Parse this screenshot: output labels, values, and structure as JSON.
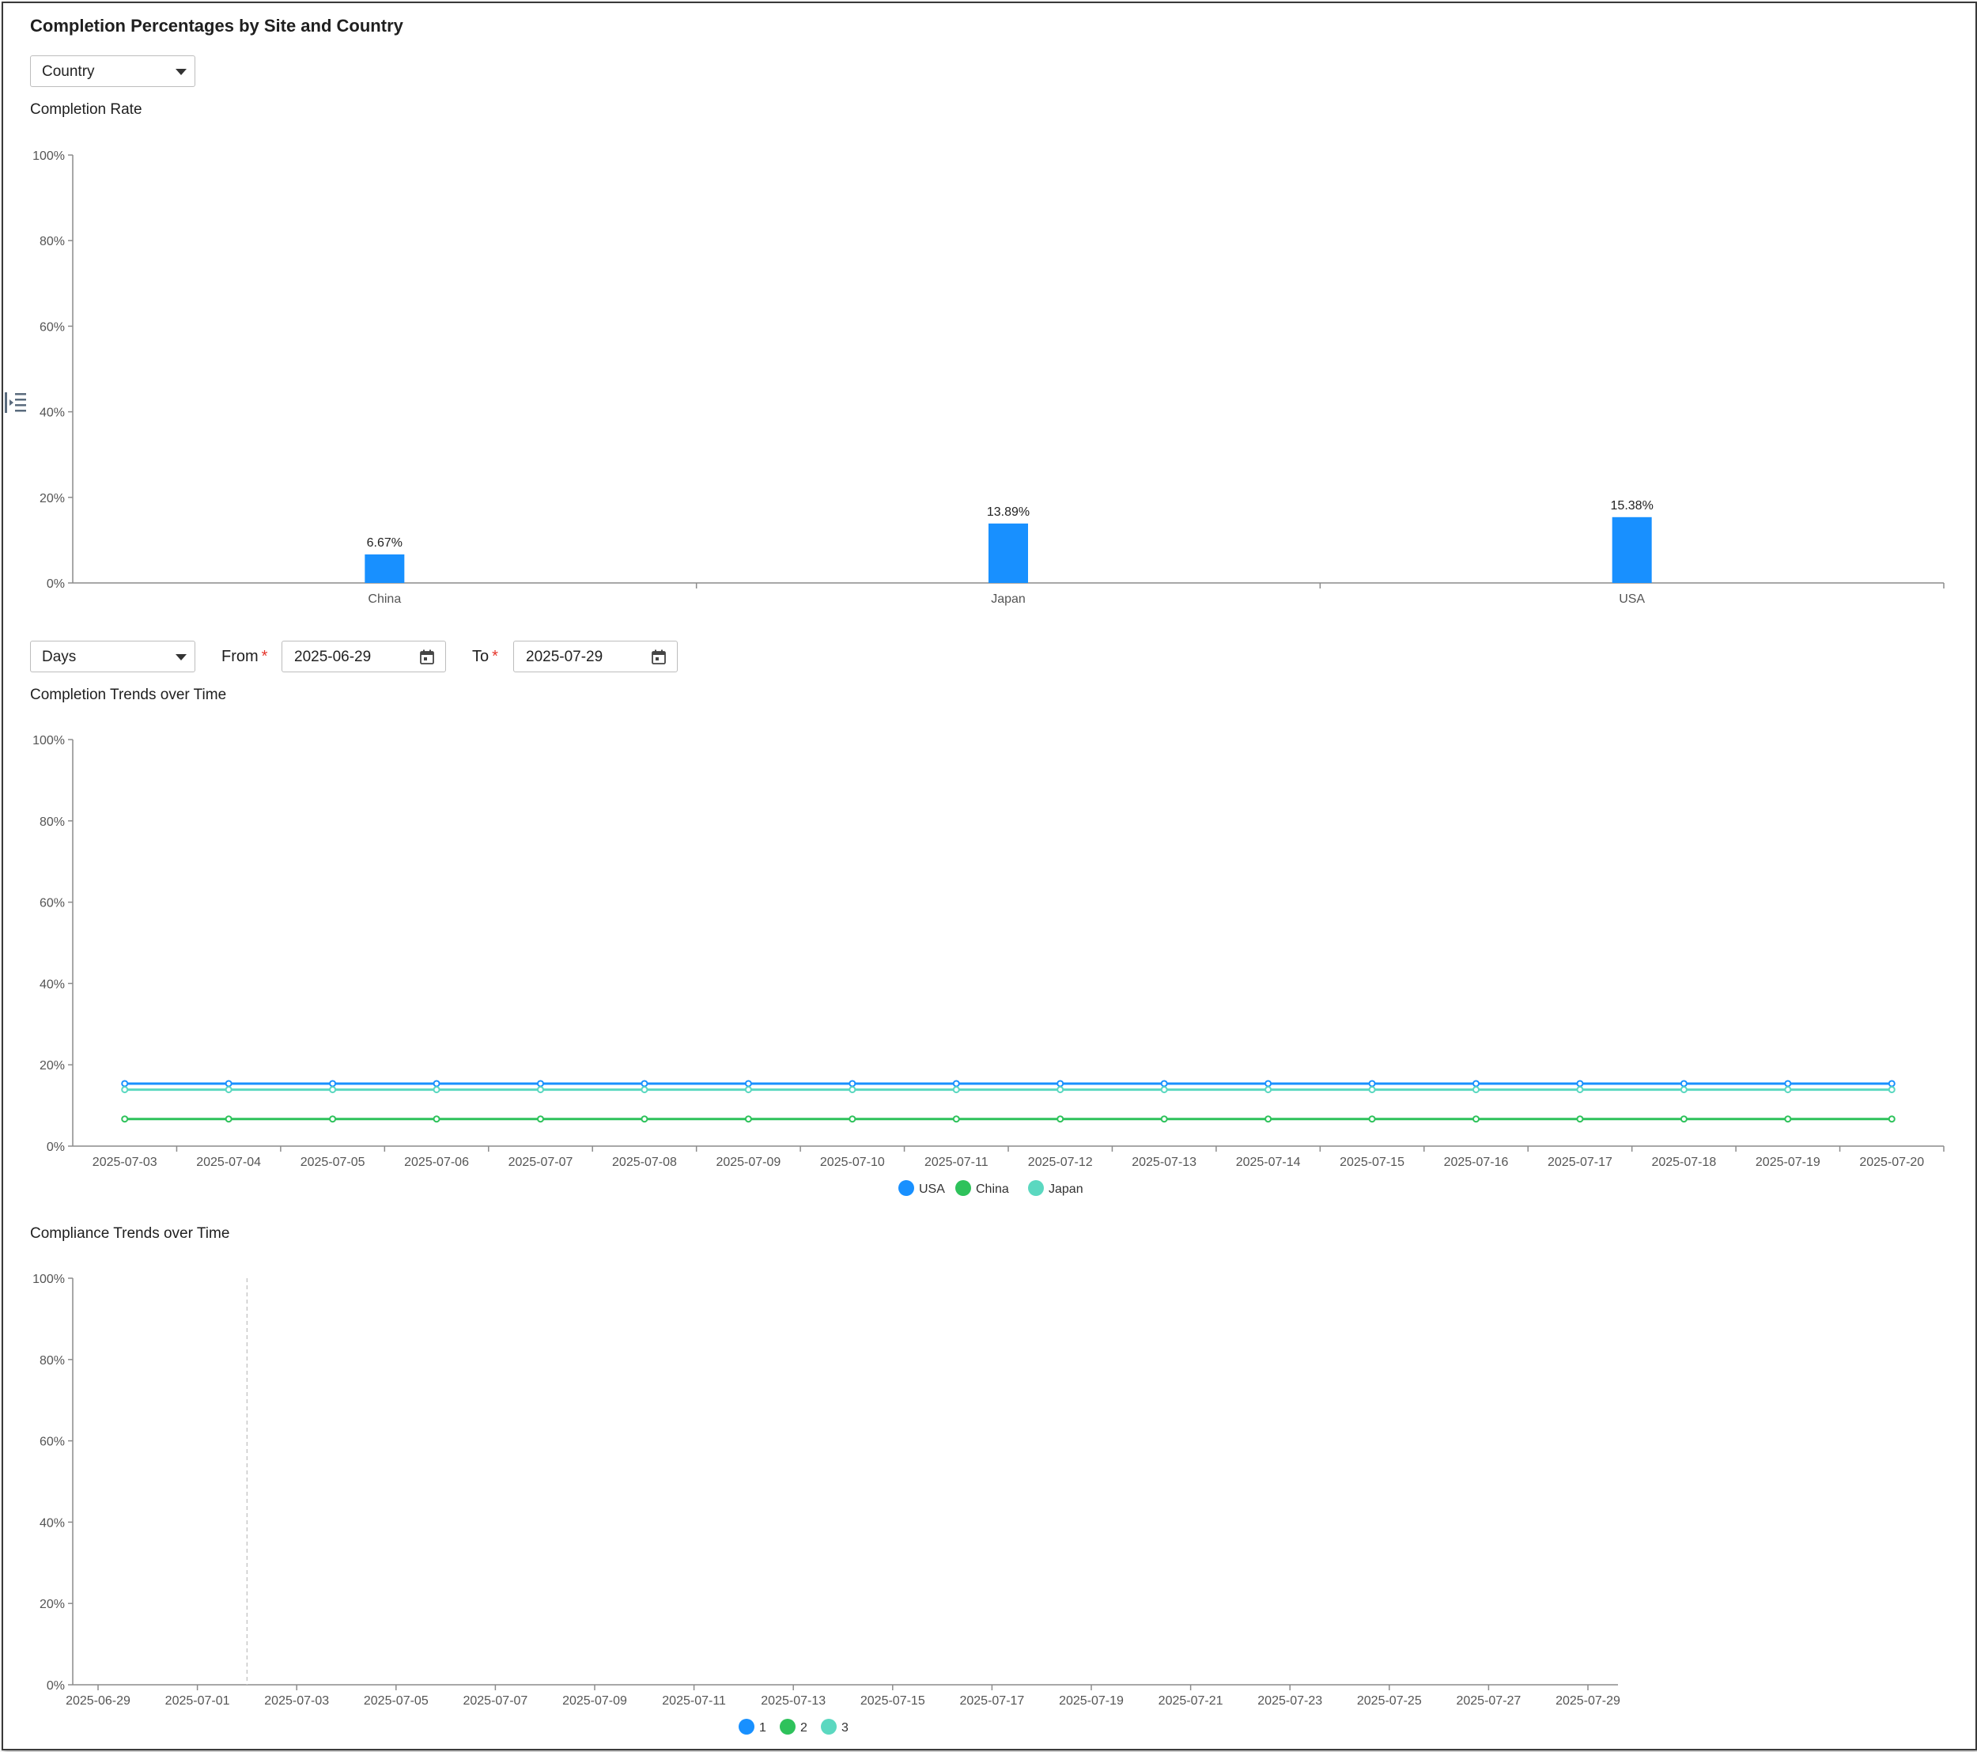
{
  "page": {
    "title": "Completion Percentages by Site and Country"
  },
  "grouping_select": {
    "value": "Country"
  },
  "period_select": {
    "value": "Days"
  },
  "date_range": {
    "from_label": "From",
    "from_value": "2025-06-29",
    "to_label": "To",
    "to_value": "2025-07-29",
    "required_mark": "*"
  },
  "sections": {
    "completion_rate": "Completion Rate",
    "completion_trends": "Completion Trends over Time",
    "compliance_trends": "Compliance Trends over Time"
  },
  "icons": {
    "sidebar_toggle": "indent-menu-icon",
    "calendar": "calendar-icon",
    "dropdown": "chevron-down-icon"
  },
  "colors": {
    "usa": "#1890ff",
    "china": "#2ec25b",
    "japan": "#5bd8c0",
    "axis": "#8c8c8c"
  },
  "chart_data": [
    {
      "id": "completion_rate",
      "type": "bar",
      "title": "Completion Rate",
      "categories": [
        "China",
        "Japan",
        "USA"
      ],
      "values": [
        6.67,
        13.89,
        15.38
      ],
      "data_labels": [
        "6.67%",
        "13.89%",
        "15.38%"
      ],
      "yticks": [
        "0%",
        "20%",
        "40%",
        "60%",
        "80%",
        "100%"
      ],
      "ylim": [
        0,
        100
      ],
      "grid": false
    },
    {
      "id": "completion_trends",
      "type": "line",
      "title": "Completion Trends over Time",
      "x": [
        "2025-07-03",
        "2025-07-04",
        "2025-07-05",
        "2025-07-06",
        "2025-07-07",
        "2025-07-08",
        "2025-07-09",
        "2025-07-10",
        "2025-07-11",
        "2025-07-12",
        "2025-07-13",
        "2025-07-14",
        "2025-07-15",
        "2025-07-16",
        "2025-07-17",
        "2025-07-18",
        "2025-07-19",
        "2025-07-20"
      ],
      "series": [
        {
          "name": "USA",
          "values": [
            15.38,
            15.38,
            15.38,
            15.38,
            15.38,
            15.38,
            15.38,
            15.38,
            15.38,
            15.38,
            15.38,
            15.38,
            15.38,
            15.38,
            15.38,
            15.38,
            15.38,
            15.38
          ]
        },
        {
          "name": "China",
          "values": [
            6.67,
            6.67,
            6.67,
            6.67,
            6.67,
            6.67,
            6.67,
            6.67,
            6.67,
            6.67,
            6.67,
            6.67,
            6.67,
            6.67,
            6.67,
            6.67,
            6.67,
            6.67
          ]
        },
        {
          "name": "Japan",
          "values": [
            13.89,
            13.89,
            13.89,
            13.89,
            13.89,
            13.89,
            13.89,
            13.89,
            13.89,
            13.89,
            13.89,
            13.89,
            13.89,
            13.89,
            13.89,
            13.89,
            13.89,
            13.89
          ]
        }
      ],
      "yticks": [
        "0%",
        "20%",
        "40%",
        "60%",
        "80%",
        "100%"
      ],
      "ylim": [
        0,
        100
      ],
      "legend": "bottom-center",
      "grid": false
    },
    {
      "id": "compliance_trends",
      "type": "line",
      "title": "Compliance Trends over Time",
      "x": [
        "2025-06-29",
        "2025-07-01",
        "2025-07-03",
        "2025-07-05",
        "2025-07-07",
        "2025-07-09",
        "2025-07-11",
        "2025-07-13",
        "2025-07-15",
        "2025-07-17",
        "2025-07-19",
        "2025-07-21",
        "2025-07-23",
        "2025-07-25",
        "2025-07-27",
        "2025-07-29"
      ],
      "series": [
        {
          "name": "1",
          "values": []
        },
        {
          "name": "2",
          "values": []
        },
        {
          "name": "3",
          "values": []
        }
      ],
      "yticks": [
        "0%",
        "20%",
        "40%",
        "60%",
        "80%",
        "100%"
      ],
      "ylim": [
        0,
        100
      ],
      "legend": "bottom-center",
      "grid": false
    }
  ]
}
